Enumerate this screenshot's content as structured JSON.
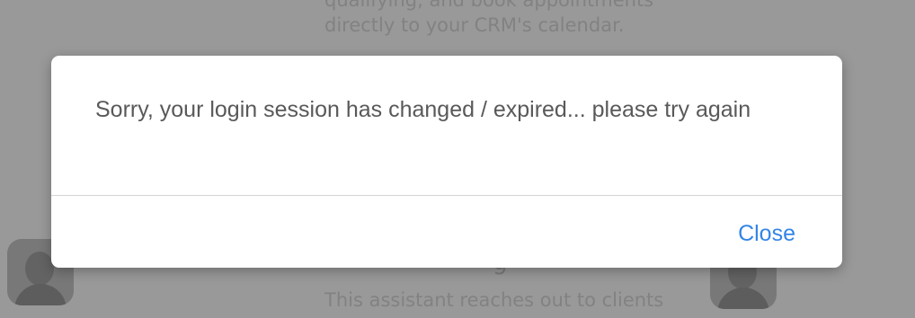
{
  "background": {
    "top_text": "qualifying, and book appointments\ndirectly to your CRM's calendar.",
    "bottom_heading_fragment": "g",
    "bottom_text": "This assistant reaches out to clients"
  },
  "modal": {
    "message": "Sorry, your login session has changed / expired... please try again",
    "close_label": "Close"
  },
  "colors": {
    "accent": "#3385e6",
    "message_text": "#595959",
    "overlay": "rgba(0,0,0,0.40)"
  }
}
